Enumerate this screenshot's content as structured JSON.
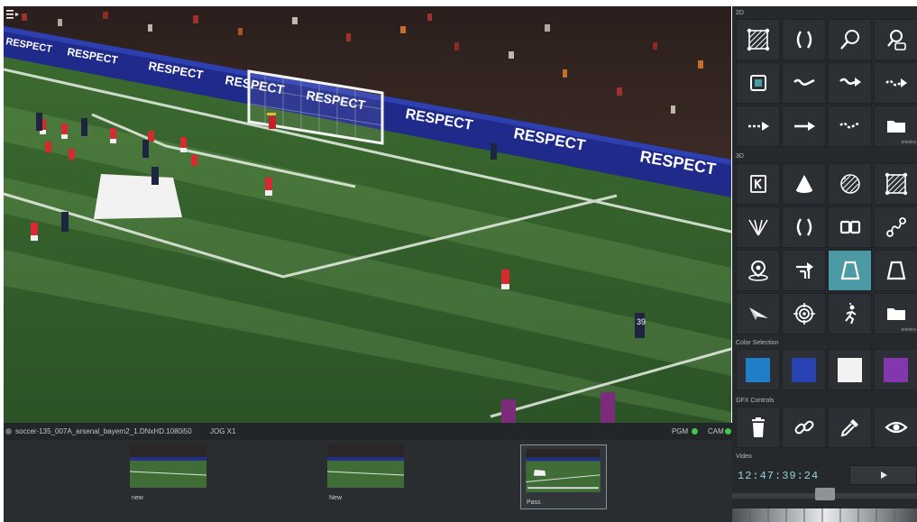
{
  "viewport": {
    "ad_board_text": "RESPECT"
  },
  "panel": {
    "sections": {
      "two_d": "2D",
      "three_d": "3D",
      "color_selection": "Color Selection",
      "gfx_controls": "GFX Controls",
      "video": "Video"
    },
    "tools_2d": [
      {
        "icon": "hatched-square-icon"
      },
      {
        "icon": "parentheses-icon"
      },
      {
        "icon": "magnifier-icon"
      },
      {
        "icon": "magnifier-window-icon"
      },
      {
        "icon": "framed-square-icon"
      },
      {
        "icon": "wavy-line-icon"
      },
      {
        "icon": "wavy-arrow-icon"
      },
      {
        "icon": "dashed-wavy-arrow-icon"
      },
      {
        "icon": "dashed-arrow-icon"
      },
      {
        "icon": "solid-arrow-icon"
      },
      {
        "icon": "dashed-curve-icon"
      },
      {
        "icon": "folder-icon",
        "caption": "telestra"
      }
    ],
    "tools_3d": [
      {
        "icon": "keyframe-k-icon"
      },
      {
        "icon": "cone-icon"
      },
      {
        "icon": "hatched-circle-icon"
      },
      {
        "icon": "hatched-square-icon"
      },
      {
        "icon": "fan-lines-icon"
      },
      {
        "icon": "parentheses-icon"
      },
      {
        "icon": "double-box-icon"
      },
      {
        "icon": "node-link-icon"
      },
      {
        "icon": "location-pin-icon"
      },
      {
        "icon": "stairs-arrow-icon"
      },
      {
        "icon": "trapezoid-icon",
        "active": true
      },
      {
        "icon": "trapezoid-outline-icon"
      },
      {
        "icon": "paper-plane-icon"
      },
      {
        "icon": "target-crosshair-icon"
      },
      {
        "icon": "running-player-icon"
      },
      {
        "icon": "folder-icon",
        "caption": "telestra"
      }
    ],
    "colors": [
      "#1f7fc6",
      "#2a43b3",
      "#f2f2f2",
      "#8436ad"
    ],
    "gfx_tools": [
      {
        "icon": "trash-icon"
      },
      {
        "icon": "chain-link-icon"
      },
      {
        "icon": "eyedropper-icon"
      },
      {
        "icon": "eye-icon"
      }
    ],
    "video": {
      "timecode": "12:47:39:24",
      "play_icon": "play-icon",
      "slider_value": 0.5
    }
  },
  "clip_bar": {
    "file_name": "soccer-135_007A_arsenal_bayern2_1.DNxHD.1080i50",
    "jog": "JOG X1",
    "pgm": "PGM",
    "cam": "CAM",
    "status_color": "#3ec94a",
    "clips": [
      {
        "label": "new",
        "selected": false
      },
      {
        "label": "New",
        "selected": false
      },
      {
        "label": "Pass",
        "selected": true
      }
    ]
  }
}
